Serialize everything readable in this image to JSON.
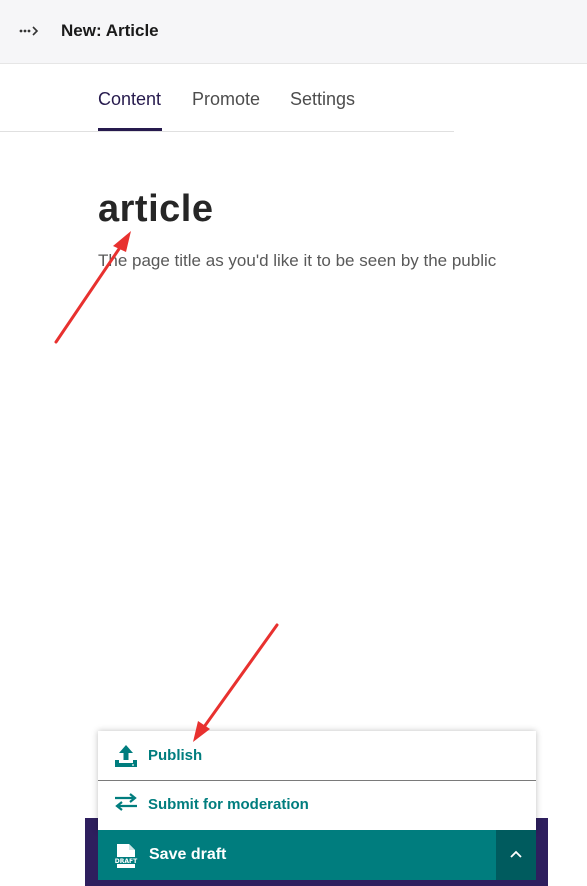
{
  "header": {
    "title": "New: Article",
    "breadcrumb_icon": "breadcrumb-expand-icon"
  },
  "tabs": [
    {
      "label": "Content",
      "active": true
    },
    {
      "label": "Promote",
      "active": false
    },
    {
      "label": "Settings",
      "active": false
    }
  ],
  "form": {
    "title_value": "article",
    "title_help": "The page title as you'd like it to be seen by the public"
  },
  "actions_menu": {
    "items": [
      {
        "label": "Publish",
        "icon": "upload-icon"
      },
      {
        "label": "Submit for moderation",
        "icon": "arrows-exchange-icon"
      }
    ],
    "primary": {
      "label": "Save draft",
      "icon": "draft-document-icon"
    },
    "toggle_icon": "chevron-up-icon"
  },
  "colors": {
    "accent_teal": "#007d7e",
    "dark_teal": "#005b5e",
    "footer_purple": "#2e1f5e",
    "active_tab": "#261a4d",
    "annotation_arrow": "#e8312f"
  }
}
